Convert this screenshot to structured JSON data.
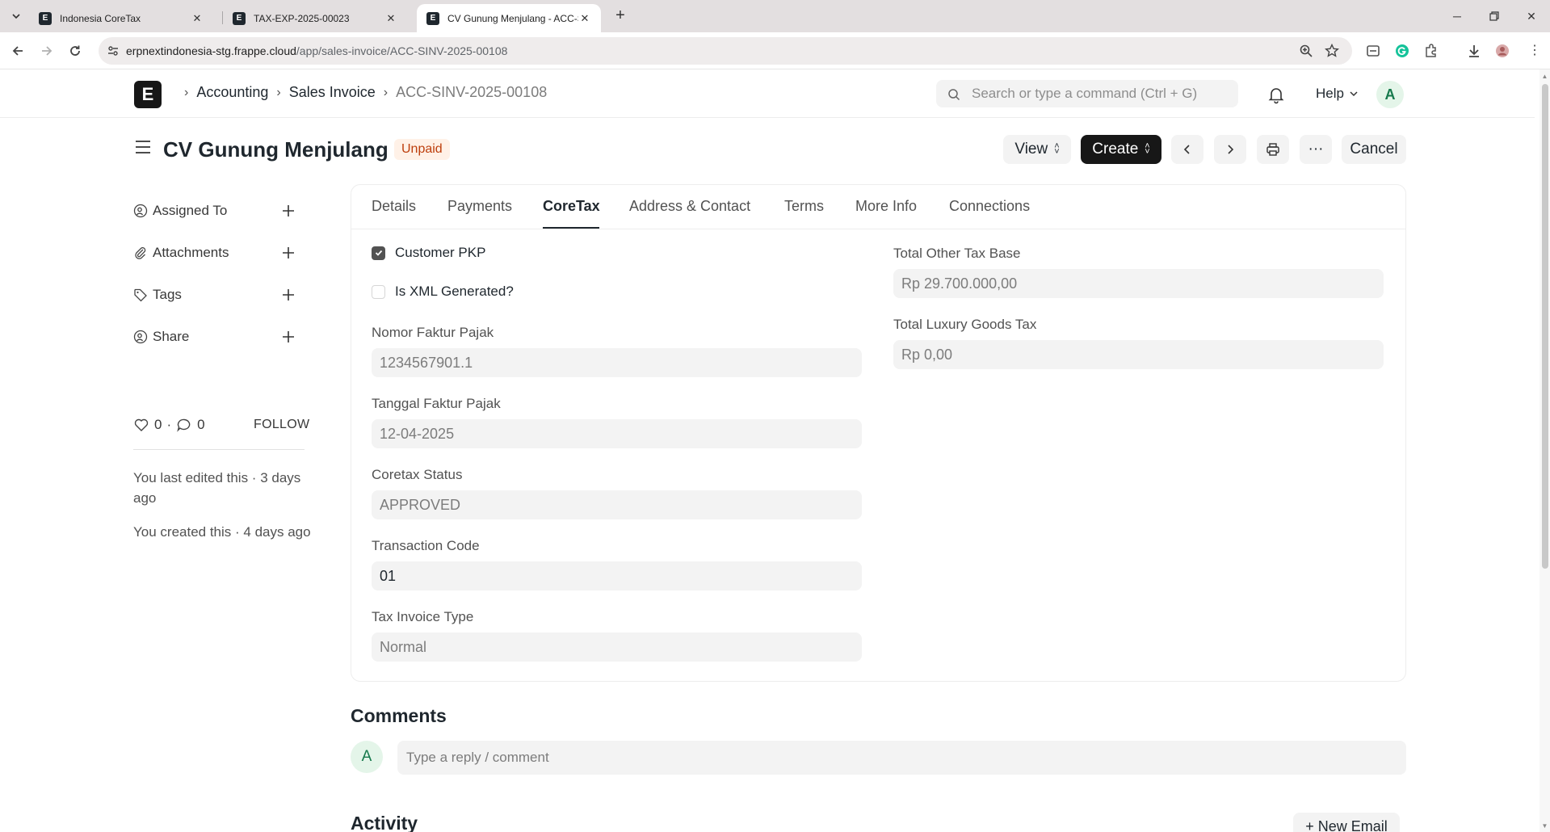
{
  "browser": {
    "tabs": [
      {
        "title": "Indonesia CoreTax",
        "favicon": "E"
      },
      {
        "title": "TAX-EXP-2025-00023",
        "favicon": "E"
      },
      {
        "title": "CV Gunung Menjulang - ACC-S",
        "favicon": "E"
      }
    ],
    "url_host": "erpnextindonesia-stg.frappe.cloud",
    "url_path": "/app/sales-invoice/ACC-SINV-2025-00108"
  },
  "navbar": {
    "logo": "E",
    "breadcrumbs": [
      "Accounting",
      "Sales Invoice",
      "ACC-SINV-2025-00108"
    ],
    "search_placeholder": "Search or type a command (Ctrl + G)",
    "help_label": "Help",
    "avatar_initial": "A"
  },
  "header": {
    "title": "CV Gunung Menjulang",
    "status": "Unpaid",
    "view_label": "View",
    "create_label": "Create",
    "more_label": "···",
    "cancel_label": "Cancel"
  },
  "sidebar": {
    "items": [
      {
        "label": "Assigned To",
        "icon": "user-add-icon"
      },
      {
        "label": "Attachments",
        "icon": "paperclip-icon"
      },
      {
        "label": "Tags",
        "icon": "tag-icon"
      },
      {
        "label": "Share",
        "icon": "share-icon"
      }
    ],
    "likes": "0",
    "likes_sep": "·",
    "comments_count": "0",
    "follow_label": "FOLLOW",
    "last_edited": "You last edited this · 3 days ago",
    "created": "You created this · 4 days ago"
  },
  "form": {
    "tabs": [
      "Details",
      "Payments",
      "CoreTax",
      "Address & Contact",
      "Terms",
      "More Info",
      "Connections"
    ],
    "active_tab": "CoreTax",
    "customer_pkp": {
      "label": "Customer PKP",
      "checked": true
    },
    "is_xml_generated": {
      "label": "Is XML Generated?",
      "checked": false
    },
    "nomor_faktur": {
      "label": "Nomor Faktur Pajak",
      "value": "1234567901.1"
    },
    "tanggal_faktur": {
      "label": "Tanggal Faktur Pajak",
      "value": "12-04-2025"
    },
    "coretax_status": {
      "label": "Coretax Status",
      "value": "APPROVED"
    },
    "transaction_code": {
      "label": "Transaction Code",
      "value": "01"
    },
    "tax_invoice_type": {
      "label": "Tax Invoice Type",
      "value": "Normal"
    },
    "total_other_tax_base": {
      "label": "Total Other Tax Base",
      "value": "Rp 29.700.000,00"
    },
    "total_luxury_goods_tax": {
      "label": "Total Luxury Goods Tax",
      "value": "Rp 0,00"
    }
  },
  "comments": {
    "heading": "Comments",
    "avatar_initial": "A",
    "placeholder": "Type a reply / comment"
  },
  "activity": {
    "heading": "Activity",
    "new_email_label": "+ New Email"
  },
  "colors": {
    "primary_dark": "#171717",
    "status_unpaid_bg": "#fff1e7",
    "status_unpaid_text": "#bd3e0c",
    "avatar_bg": "#e4f5e9",
    "avatar_text": "#16794c"
  }
}
